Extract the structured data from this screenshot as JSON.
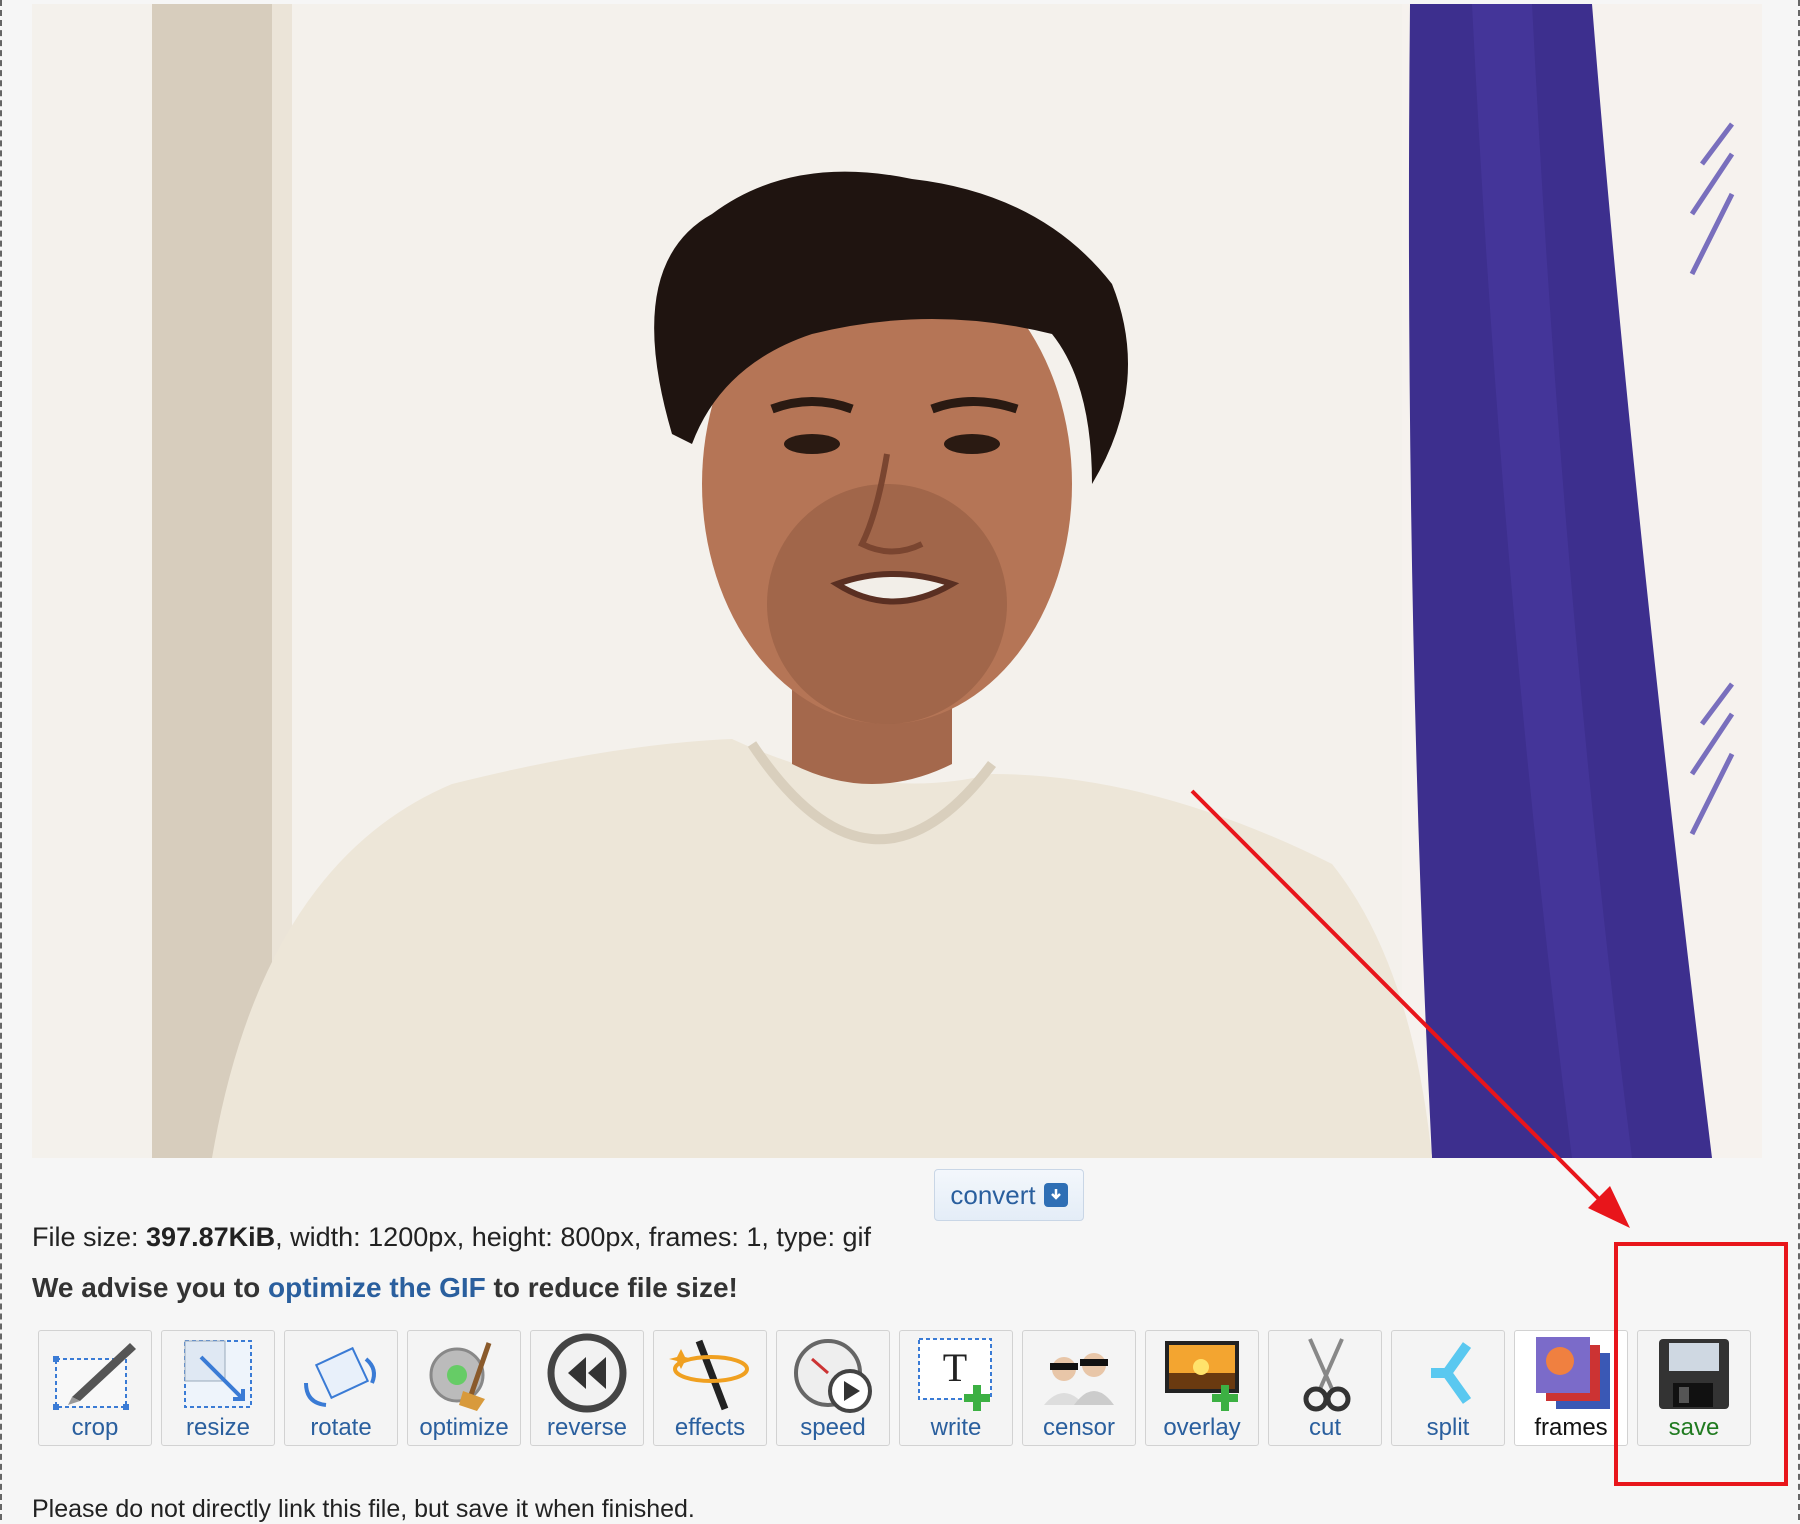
{
  "convert": {
    "label": "convert"
  },
  "file_info": {
    "prefix": "File size: ",
    "size": "397.87KiB",
    "rest": ", width: 1200px, height: 800px, frames: 1, type: gif"
  },
  "advice": {
    "before": "We advise you to ",
    "link": "optimize the GIF",
    "after": " to reduce file size!"
  },
  "toolbar": {
    "items": [
      {
        "label": "crop",
        "icon": "crop-icon"
      },
      {
        "label": "resize",
        "icon": "resize-icon"
      },
      {
        "label": "rotate",
        "icon": "rotate-icon"
      },
      {
        "label": "optimize",
        "icon": "optimize-icon"
      },
      {
        "label": "reverse",
        "icon": "reverse-icon"
      },
      {
        "label": "effects",
        "icon": "effects-icon"
      },
      {
        "label": "speed",
        "icon": "speed-icon"
      },
      {
        "label": "write",
        "icon": "write-icon"
      },
      {
        "label": "censor",
        "icon": "censor-icon"
      },
      {
        "label": "overlay",
        "icon": "overlay-icon"
      },
      {
        "label": "cut",
        "icon": "cut-icon"
      },
      {
        "label": "split",
        "icon": "split-icon"
      },
      {
        "label": "frames",
        "icon": "frames-icon"
      },
      {
        "label": "save",
        "icon": "save-icon"
      }
    ]
  },
  "hint": {
    "text": "Please do not directly link this file, but save it when finished."
  },
  "colors": {
    "link": "#2a5f9e",
    "annotation": "#e8151b",
    "save_label": "#1f7a1f"
  }
}
